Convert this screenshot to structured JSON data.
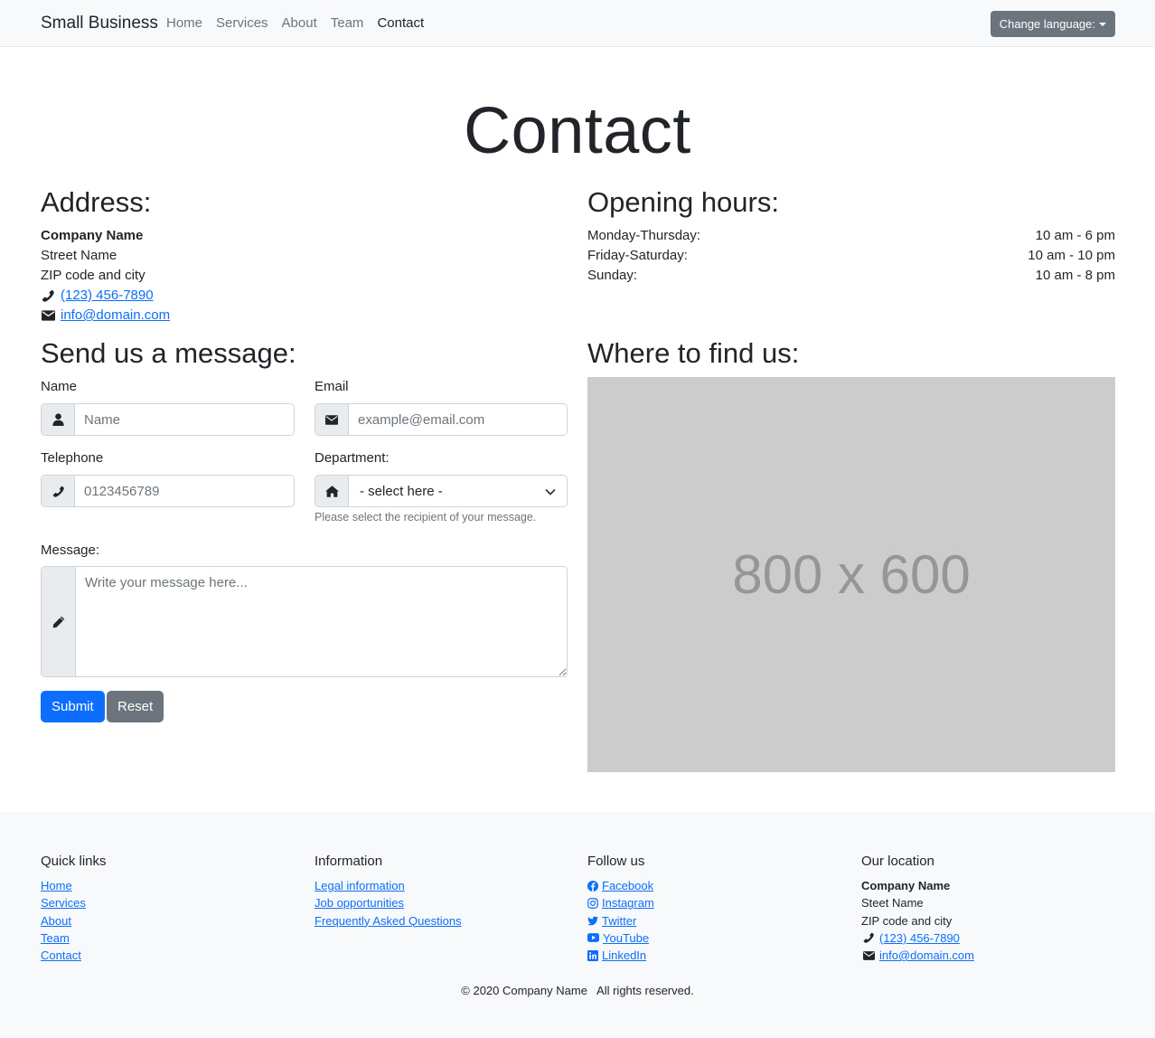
{
  "navbar": {
    "brand": "Small Business",
    "links": [
      "Home",
      "Services",
      "About",
      "Team",
      "Contact"
    ],
    "language_button": "Change language:"
  },
  "page_title": "Contact",
  "address": {
    "heading": "Address:",
    "company": "Company Name",
    "street": "Street Name",
    "city": "ZIP code and city",
    "phone": "(123) 456-7890",
    "email": "info@domain.com"
  },
  "hours": {
    "heading": "Opening hours:",
    "rows": [
      {
        "day": "Monday-Thursday:",
        "time": "10 am - 6 pm"
      },
      {
        "day": "Friday-Saturday:",
        "time": "10 am - 10 pm"
      },
      {
        "day": "Sunday:",
        "time": "10 am - 8 pm"
      }
    ]
  },
  "form": {
    "heading": "Send us a message:",
    "name_label": "Name",
    "name_placeholder": "Name",
    "email_label": "Email",
    "email_placeholder": "example@email.com",
    "telephone_label": "Telephone",
    "telephone_placeholder": "0123456789",
    "department_label": "Department:",
    "department_selected": "- select here -",
    "department_help": "Please select the recipient of your message.",
    "message_label": "Message:",
    "message_placeholder": "Write your message here...",
    "submit": "Submit",
    "reset": "Reset"
  },
  "map": {
    "heading": "Where to find us:",
    "placeholder_text": "800 x 600"
  },
  "footer": {
    "quick_links": {
      "heading": "Quick links",
      "items": [
        "Home",
        "Services",
        "About",
        "Team",
        "Contact"
      ]
    },
    "information": {
      "heading": "Information",
      "items": [
        "Legal information",
        "Job opportunities",
        "Frequently Asked Questions"
      ]
    },
    "follow": {
      "heading": "Follow us",
      "items": [
        {
          "label": " Facebook",
          "icon": "facebook-icon"
        },
        {
          "label": " Instagram",
          "icon": "instagram-icon"
        },
        {
          "label": " Twitter",
          "icon": "twitter-icon"
        },
        {
          "label": " YouTube",
          "icon": "youtube-icon"
        },
        {
          "label": " LinkedIn",
          "icon": "linkedin-icon"
        }
      ]
    },
    "location": {
      "heading": "Our location",
      "company": "Company Name",
      "street": "Steet Name",
      "city": "ZIP code and city",
      "phone": "(123) 456-7890",
      "email": "info@domain.com"
    },
    "copyright": "© 2020 Company Name   All rights reserved."
  },
  "colors": {
    "primary": "#0d6efd",
    "secondary": "#6c757d",
    "light_bg": "#f8f9fa",
    "map_bg": "#cccccc"
  }
}
